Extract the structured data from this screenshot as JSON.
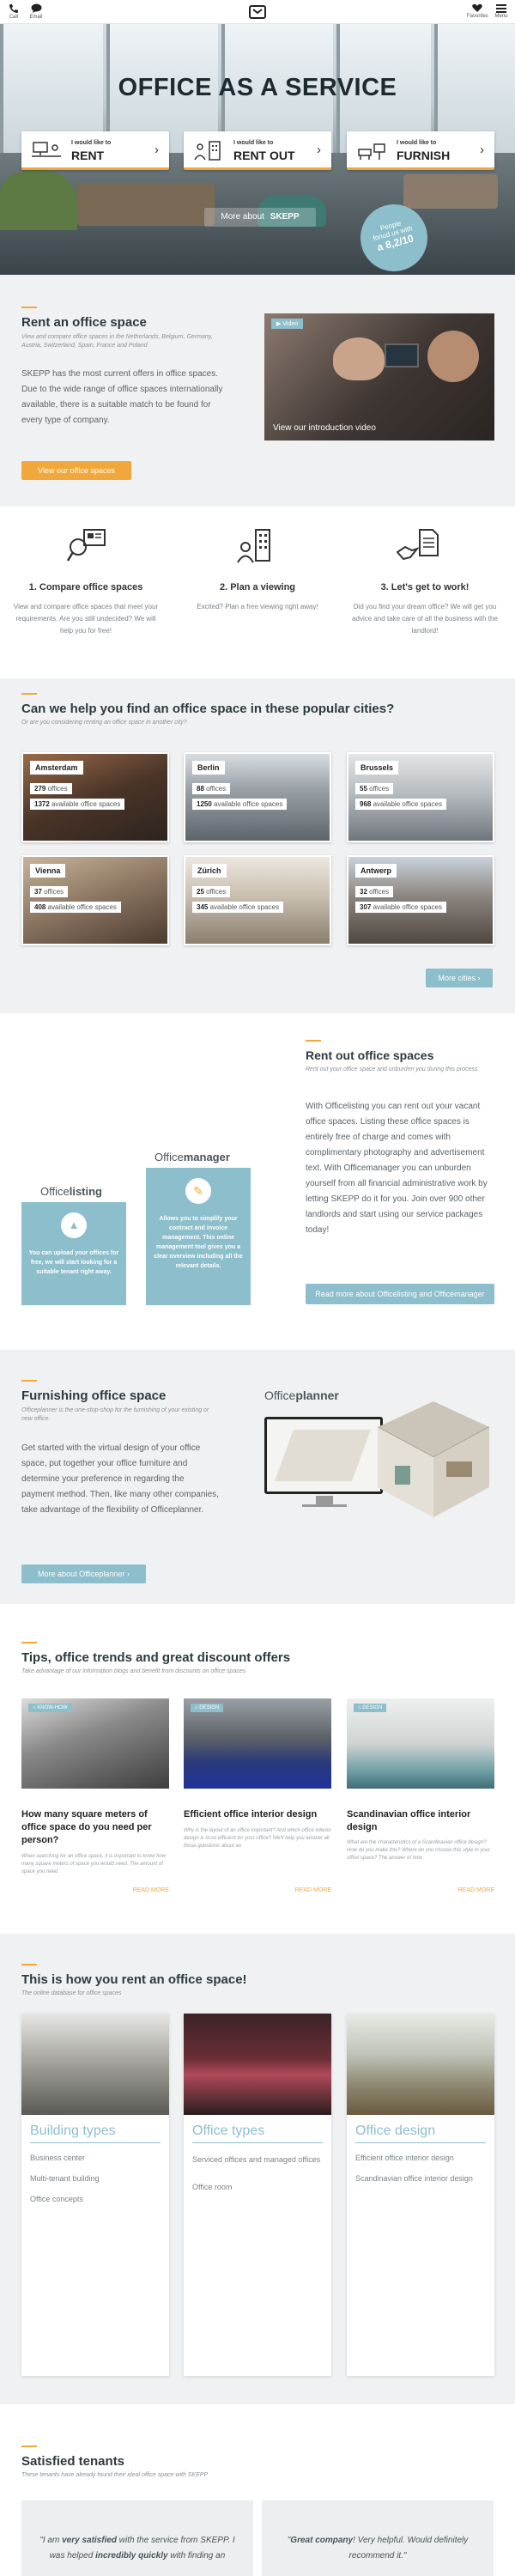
{
  "nav": {
    "left": [
      {
        "label": "Call",
        "icon": "phone-icon"
      },
      {
        "label": "Email",
        "icon": "chat-icon"
      }
    ],
    "right": [
      {
        "label": "Favorites",
        "icon": "heart-icon"
      },
      {
        "label": "Menu",
        "icon": "menu-icon"
      }
    ],
    "logo": "skepp-logo"
  },
  "hero": {
    "title": "OFFICE AS A SERVICE",
    "ctas": [
      {
        "small": "I would like to",
        "big": "RENT",
        "icon": "monitor-desk-icon"
      },
      {
        "small": "I would like to",
        "big": "RENT OUT",
        "icon": "building-icon"
      },
      {
        "small": "I would like to",
        "big": "FURNISH",
        "icon": "furniture-icon"
      }
    ],
    "more_about": "More about",
    "brand": "SKEPP",
    "badge": {
      "line1": "People",
      "line2": "fonud us with",
      "line3": "a 8,2/10"
    }
  },
  "intro": {
    "title": "Rent an office space",
    "subtitle": "View and compare office spaces in the Netherlands, Belgium, Germany, Austria, Switzerland, Spain, France and Poland",
    "body": "SKEPP has the most current offers in office spaces. Due to the wide range of office spaces internationally available, there is a suitable match to be found for every type of company.",
    "button": "View our office spaces",
    "video_tag": "Video",
    "video_caption": "View our introduction video"
  },
  "steps": [
    {
      "title": "1. Compare office spaces",
      "desc": "View and compare office spaces that meet your requirements. Are you still undecided? We will help you for free!",
      "icon": "compare-icon"
    },
    {
      "title": "2. Plan a viewing",
      "desc": "Excited? Plan a free viewing right away!",
      "icon": "viewing-icon"
    },
    {
      "title": "3. Let's get to work!",
      "desc": "Did you find your dream office? We will get you advice and take care of all the business with the landlord!",
      "icon": "handshake-icon"
    }
  ],
  "cities": {
    "title": "Can we help you find an office space in these popular cities?",
    "subtitle": "Or are you considering renting an office space in another city?",
    "offices_label": "offices",
    "available_label": "available office spaces",
    "items": [
      {
        "name": "Amsterdam",
        "offices": "279",
        "available": "1372"
      },
      {
        "name": "Berlin",
        "offices": "88",
        "available": "1250"
      },
      {
        "name": "Brussels",
        "offices": "55",
        "available": "968"
      },
      {
        "name": "Vienna",
        "offices": "37",
        "available": "408"
      },
      {
        "name": "Zürich",
        "offices": "25",
        "available": "345"
      },
      {
        "name": "Antwerp",
        "offices": "32",
        "available": "307"
      }
    ],
    "more": "More cities"
  },
  "rentout": {
    "title": "Rent out office spaces",
    "subtitle": "Rent out your office space and unburden you during this process",
    "body": "With Officelisting you can rent out your vacant office spaces. Listing these office spaces is entirely free of charge and comes with complimentary photography and advertisement text. With Officemanager you can unburden yourself from all financial administrative work by letting SKEPP do it for you. Join over 900 other landlords and start using our service packages today!",
    "button": "Read more about Officelisting and Officemanager",
    "listing_a": "Office",
    "listing_b": "listing",
    "listing_text": "You can upload your offices for free, we will start looking for a suitable tenant right away.",
    "manager_a": "Office",
    "manager_b": "manager",
    "manager_text": "Allows you to simplify your contract and invoice management. This online management tool gives you a clear overview including all the relevant details."
  },
  "furnish": {
    "title": "Furnishing office space",
    "subtitle": "Officeplanner is the one-stop-shop for the furnishing of your existing or new office.",
    "body": "Get started with the virtual design of your office space, put together your office furniture and determine your preference in regarding the payment method. Then, like many other companies, take advantage of the flexibility of Officeplanner.",
    "button": "More about Officeplanner",
    "planner_a": "Office",
    "planner_b": "planner"
  },
  "tips": {
    "title": "Tips, office trends and great discount offers",
    "subtitle": "Take advantage of our information blogs and benefit from discounts on office spaces",
    "read_more": "READ MORE",
    "items": [
      {
        "tag": "KNOW-HOW",
        "title": "How many square meters of office space do you need per person?",
        "desc": "When searching for an office space, it is important to know how many square meters of space you would need. The amount of space you need"
      },
      {
        "tag": "DESIGN",
        "title": "Efficient office interior design",
        "desc": "Why is the layout of an office important? And which office interior design is most efficient for your office? We'll help you answer all those questions about an"
      },
      {
        "tag": "DESIGN",
        "title": "Scandinavian office interior design",
        "desc": "What are the characteristics of a Scandinavian office design? How do you make this? Where do you choose this style in your office space? The answer of how"
      }
    ]
  },
  "howto": {
    "title": "This is how you rent an office space!",
    "subtitle": "The online database for office spaces",
    "cards": [
      {
        "title": "Building types",
        "items": [
          "Business center",
          "Multi-tenant building",
          "Office concepts"
        ]
      },
      {
        "title": "Office types",
        "items": [
          "Serviced offices and managed offices",
          "Office room"
        ]
      },
      {
        "title": "Office design",
        "items": [
          "Efficient office interior design",
          "Scandinavian office interior design"
        ]
      }
    ]
  },
  "tenants": {
    "title": "Satisfied tenants",
    "subtitle": "These tenants have already found their ideal office space with SKEPP",
    "quote1_a": "\"I am ",
    "quote1_b": "very satisfied",
    "quote1_c": " with the service from SKEPP. I was helped ",
    "quote1_d": "incredibly quickly",
    "quote1_e": " with finding an",
    "quote2_a": "\"",
    "quote2_b": "Great company",
    "quote2_c": "! Very helpful. Would definitely recommend it.\""
  },
  "colors": {
    "accent": "#f0a83c",
    "teal": "#8dbecb",
    "text": "#3b4248",
    "bg_gray": "#f0f1f2"
  }
}
